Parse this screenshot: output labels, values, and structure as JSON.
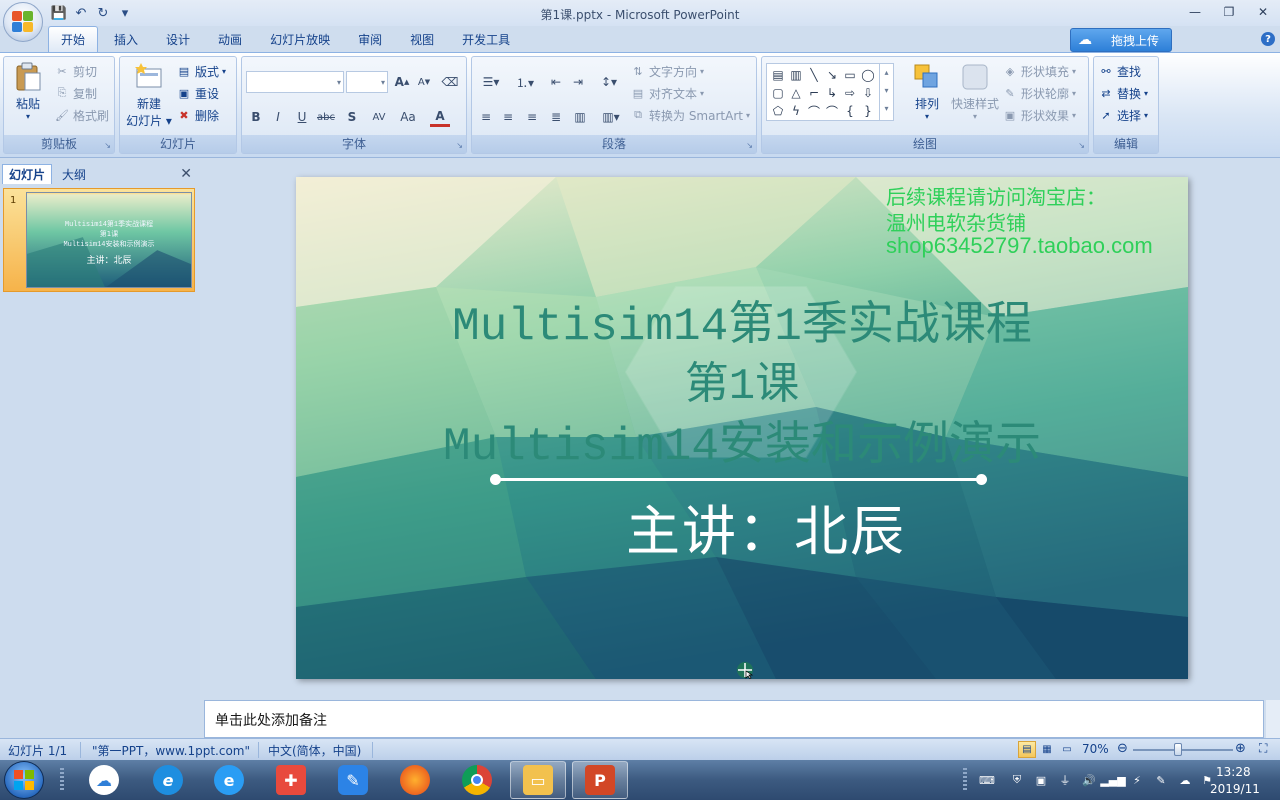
{
  "window": {
    "title": "第1课.pptx - Microsoft PowerPoint"
  },
  "qat": {
    "save": "save-icon",
    "undo": "undo-icon",
    "redo": "redo-icon",
    "more": "▾"
  },
  "tabs": [
    {
      "label": "开始",
      "active": true
    },
    {
      "label": "插入"
    },
    {
      "label": "设计"
    },
    {
      "label": "动画"
    },
    {
      "label": "幻灯片放映"
    },
    {
      "label": "审阅"
    },
    {
      "label": "视图"
    },
    {
      "label": "开发工具"
    }
  ],
  "upload_button": "拖拽上传",
  "ribbon": {
    "clipboard": {
      "label": "剪贴板",
      "paste": "粘贴",
      "cut": "剪切",
      "copy": "复制",
      "format_painter": "格式刷"
    },
    "slides": {
      "label": "幻灯片",
      "new_slide_1": "新建",
      "new_slide_2": "幻灯片",
      "layout": "版式",
      "reset": "重设",
      "delete": "删除"
    },
    "font": {
      "label": "字体",
      "buttons": [
        "B",
        "I",
        "U",
        "abc",
        "S",
        "AV",
        "Aa",
        "A"
      ],
      "grow": "A",
      "shrink": "A"
    },
    "paragraph": {
      "label": "段落",
      "text_direction": "文字方向",
      "align_text": "对齐文本",
      "smartart": "转换为 SmartArt"
    },
    "drawing": {
      "label": "绘图",
      "arrange": "排列",
      "quick_styles": "快速样式",
      "shape_fill": "形状填充",
      "shape_outline": "形状轮廓",
      "shape_effects": "形状效果"
    },
    "editing": {
      "label": "编辑",
      "find": "查找",
      "replace": "替换",
      "select": "选择"
    }
  },
  "left_pane": {
    "tab_slides": "幻灯片",
    "tab_outline": "大纲",
    "close": "✕",
    "thumb_number": "1",
    "thumb_title_1": "Multisim14第1季实战课程",
    "thumb_title_2": "第1课",
    "thumb_title_3": "Multisim14安装和示例演示",
    "thumb_presenter": "主讲：北辰"
  },
  "slide": {
    "promo_1": "后续课程请访问淘宝店：",
    "promo_2": "温州电软杂货铺",
    "promo_3": "shop63452797.taobao.com",
    "title_1": "Multisim14第1季实战课程",
    "title_2": "第1课",
    "title_3": "Multisim14安装和示例演示",
    "presenter": "主讲：北辰"
  },
  "notes": {
    "placeholder": "单击此处添加备注"
  },
  "status": {
    "slide_count": "幻灯片 1/1",
    "theme": "\"第一PPT，www.1ppt.com\"",
    "language": "中文(简体，中国)",
    "zoom": "70%",
    "zoom_level": 0.45
  },
  "taskbar": {
    "time": "13:28",
    "date": "2019/11"
  },
  "colors": {
    "promo": "#2fd05a",
    "title": "#2c8a78",
    "presenter": "#ffffff",
    "ribbon_text": "#15428b"
  }
}
